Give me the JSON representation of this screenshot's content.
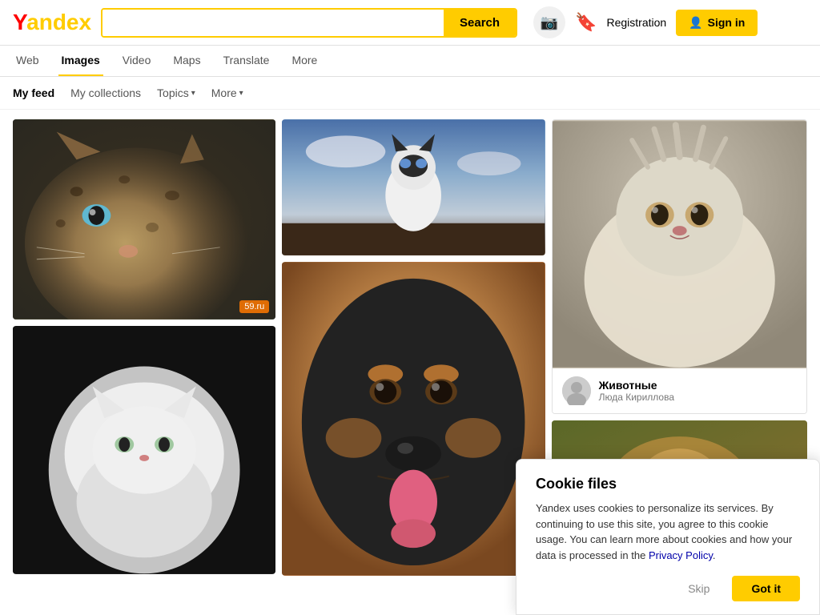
{
  "logo": {
    "text_y": "Y",
    "text_andex": "andex"
  },
  "search": {
    "placeholder": "",
    "button_label": "Search"
  },
  "header": {
    "camera_icon": "📷",
    "bookmark_icon": "🔖",
    "registration_label": "Registration",
    "signin_label": "Sign in",
    "signin_icon": "👤"
  },
  "nav_tabs": [
    {
      "label": "Web",
      "active": false
    },
    {
      "label": "Images",
      "active": true
    },
    {
      "label": "Video",
      "active": false
    },
    {
      "label": "Maps",
      "active": false
    },
    {
      "label": "Translate",
      "active": false
    },
    {
      "label": "More",
      "active": false
    }
  ],
  "sub_nav": [
    {
      "label": "My feed",
      "active": true
    },
    {
      "label": "My collections",
      "active": false
    },
    {
      "label": "Topics",
      "active": false,
      "dropdown": true
    },
    {
      "label": "More",
      "active": false,
      "dropdown": true
    }
  ],
  "images": {
    "col1": [
      {
        "id": "leopard",
        "alt": "Leopard cub close-up",
        "badge": "59.ru"
      },
      {
        "id": "white-cat",
        "alt": "White fluffy cat on dark background"
      }
    ],
    "col2": [
      {
        "id": "husky",
        "alt": "Husky dog in snowy landscape"
      },
      {
        "id": "black-dog",
        "alt": "Black dog smiling close-up"
      }
    ],
    "col3": [
      {
        "id": "fluffy-cat-collection",
        "alt": "Fluffy cat collection",
        "collection_title": "Животные",
        "collection_author": "Люда Кириллова"
      },
      {
        "id": "bottom-right",
        "alt": "Animal in nature"
      }
    ]
  },
  "cookie": {
    "title": "Cookie files",
    "text": "Yandex uses cookies to personalize its services. By continuing to use this site, you agree to this cookie usage. You can learn more about cookies and how your data is processed in the",
    "link_text": "Privacy Policy",
    "dot": ".",
    "skip_label": "Skip",
    "gotit_label": "Got it"
  }
}
